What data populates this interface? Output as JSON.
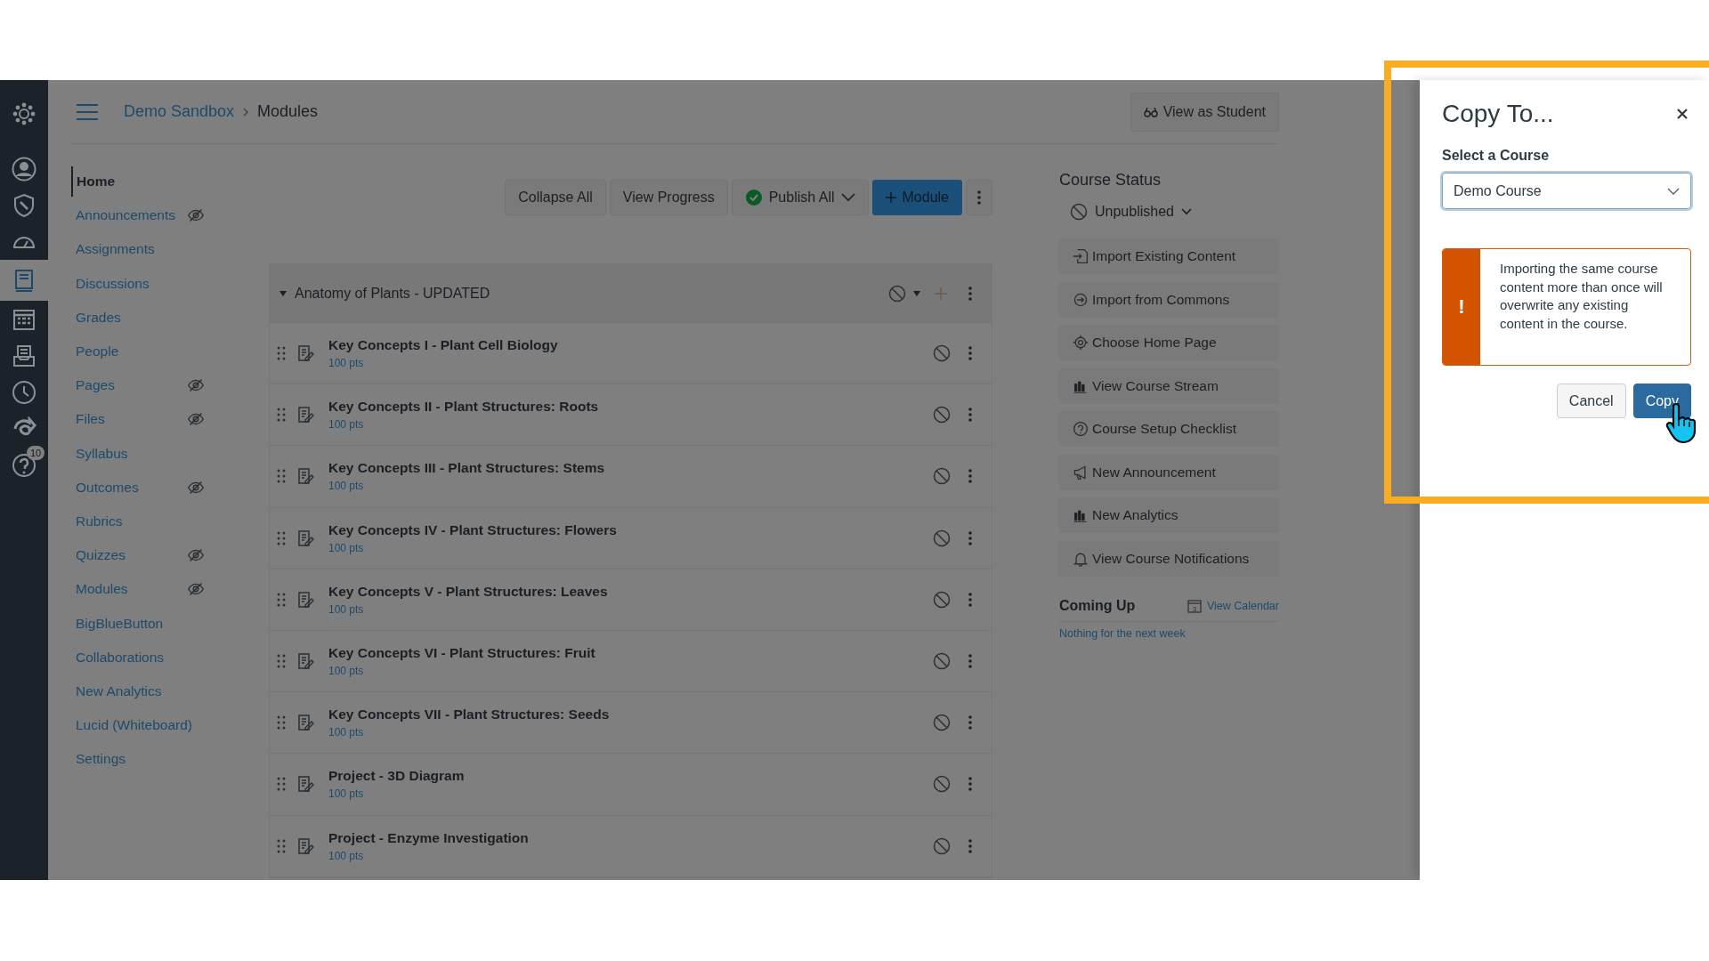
{
  "global_nav": {
    "items": [
      {
        "kind": "logo",
        "selected": false
      },
      {
        "kind": "account",
        "selected": false
      },
      {
        "kind": "admin",
        "selected": false
      },
      {
        "kind": "dashboard",
        "selected": false
      },
      {
        "kind": "courses",
        "selected": true
      },
      {
        "kind": "calendar",
        "selected": false
      },
      {
        "kind": "inbox",
        "selected": false
      },
      {
        "kind": "history",
        "selected": false
      },
      {
        "kind": "commons",
        "selected": false
      },
      {
        "kind": "help",
        "selected": false,
        "badge": "10"
      }
    ]
  },
  "header": {
    "breadcrumb": [
      "Demo Sandbox",
      "Modules"
    ],
    "view_as_student": "View as Student"
  },
  "course_nav": [
    {
      "label": "Home",
      "selected": true,
      "hidden": false
    },
    {
      "label": "Announcements",
      "selected": false,
      "hidden": true
    },
    {
      "label": "Assignments",
      "selected": false,
      "hidden": false
    },
    {
      "label": "Discussions",
      "selected": false,
      "hidden": false
    },
    {
      "label": "Grades",
      "selected": false,
      "hidden": false
    },
    {
      "label": "People",
      "selected": false,
      "hidden": false
    },
    {
      "label": "Pages",
      "selected": false,
      "hidden": true
    },
    {
      "label": "Files",
      "selected": false,
      "hidden": true
    },
    {
      "label": "Syllabus",
      "selected": false,
      "hidden": false
    },
    {
      "label": "Outcomes",
      "selected": false,
      "hidden": true
    },
    {
      "label": "Rubrics",
      "selected": false,
      "hidden": false
    },
    {
      "label": "Quizzes",
      "selected": false,
      "hidden": true
    },
    {
      "label": "Modules",
      "selected": false,
      "hidden": true
    },
    {
      "label": "BigBlueButton",
      "selected": false,
      "hidden": false
    },
    {
      "label": "Collaborations",
      "selected": false,
      "hidden": false
    },
    {
      "label": "New Analytics",
      "selected": false,
      "hidden": false
    },
    {
      "label": "Lucid (Whiteboard)",
      "selected": false,
      "hidden": false
    },
    {
      "label": "Settings",
      "selected": false,
      "hidden": false
    }
  ],
  "toolbar": {
    "collapse_all": "Collapse All",
    "view_progress": "View Progress",
    "publish_all": "Publish All",
    "add_module": "Module"
  },
  "module": {
    "title": "Anatomy of Plants - UPDATED",
    "expanded": true,
    "published": false,
    "items": [
      {
        "title": "Key Concepts I - Plant Cell Biology",
        "points": "100 pts",
        "published": false
      },
      {
        "title": "Key Concepts II - Plant Structures: Roots",
        "points": "100 pts",
        "published": false
      },
      {
        "title": "Key Concepts III - Plant Structures: Stems",
        "points": "100 pts",
        "published": false
      },
      {
        "title": "Key Concepts IV - Plant Structures: Flowers",
        "points": "100 pts",
        "published": false
      },
      {
        "title": "Key Concepts V - Plant Structures: Leaves",
        "points": "100 pts",
        "published": false
      },
      {
        "title": "Key Concepts VI - Plant Structures: Fruit",
        "points": "100 pts",
        "published": false
      },
      {
        "title": "Key Concepts VII - Plant Structures: Seeds",
        "points": "100 pts",
        "published": false
      },
      {
        "title": "Project - 3D Diagram",
        "points": "100 pts",
        "published": false
      },
      {
        "title": "Project - Enzyme Investigation",
        "points": "100 pts",
        "published": false
      }
    ]
  },
  "course_status": {
    "heading": "Course Status",
    "status": "Unpublished",
    "actions": [
      {
        "kind": "import",
        "label": "Import Existing Content"
      },
      {
        "kind": "commons",
        "label": "Import from Commons"
      },
      {
        "kind": "target",
        "label": "Choose Home Page"
      },
      {
        "kind": "chart",
        "label": "View Course Stream"
      },
      {
        "kind": "question",
        "label": "Course Setup Checklist"
      },
      {
        "kind": "megaphone",
        "label": "New Announcement"
      },
      {
        "kind": "chart",
        "label": "New Analytics"
      },
      {
        "kind": "bell",
        "label": "View Course Notifications"
      }
    ],
    "coming_up": {
      "heading": "Coming Up",
      "calendar_day": "3",
      "link": "View Calendar",
      "empty": "Nothing for the next week"
    }
  },
  "dialog": {
    "title": "Copy To...",
    "label": "Select a Course",
    "value": "Demo Course",
    "alert": "Importing the same course content more than once will overwrite any existing content in the course.",
    "alert_mark": "!",
    "buttons": [
      "Cancel",
      "Copy"
    ]
  }
}
